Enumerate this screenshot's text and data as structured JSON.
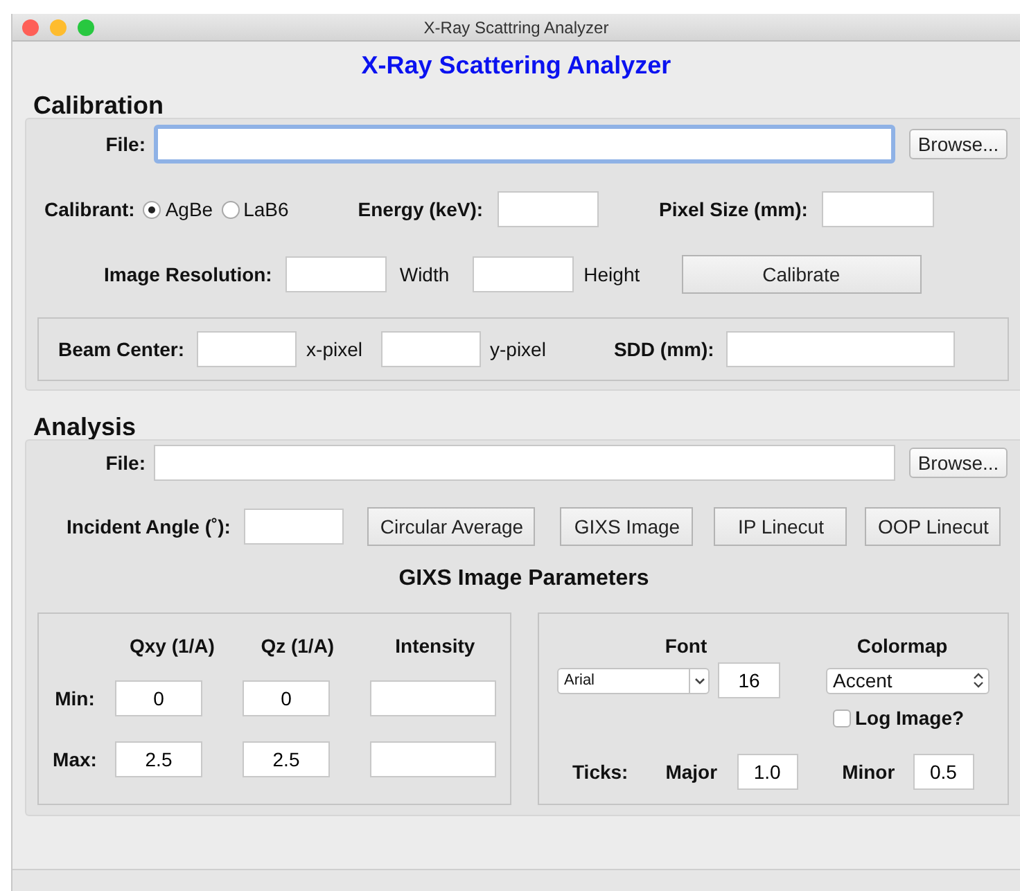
{
  "window": {
    "title": "X-Ray Scattring Analyzer"
  },
  "heading": "X-Ray Scattering Analyzer",
  "calibration": {
    "title": "Calibration",
    "file": {
      "label": "File:",
      "button": "Browse...",
      "focused": true
    },
    "calibrant": {
      "label": "Calibrant:",
      "options": [
        {
          "label": "AgBe",
          "selected": true
        },
        {
          "label": "LaB6",
          "selected": false
        }
      ]
    },
    "energy": {
      "label": "Energy (keV):"
    },
    "pixel_size": {
      "label": "Pixel Size (mm):"
    },
    "resolution": {
      "label": "Image Resolution:",
      "width_label": "Width",
      "height_label": "Height"
    },
    "calibrate_button": "Calibrate",
    "beam_center": {
      "label": "Beam Center:",
      "x_label": "x-pixel",
      "y_label": "y-pixel",
      "sdd_label": "SDD (mm):"
    }
  },
  "analysis": {
    "title": "Analysis",
    "file": {
      "label": "File:",
      "button": "Browse...",
      "focused": false
    },
    "incident_angle": {
      "label": "Incident Angle (˚):"
    },
    "buttons": [
      "Circular Average",
      "GIXS Image",
      "IP Linecut",
      "OOP Linecut"
    ],
    "parameters_title": "GIXS Image Parameters",
    "limits": {
      "columns": [
        "Qxy (1/A)",
        "Qz (1/A)",
        "Intensity"
      ],
      "rows": [
        {
          "label": "Min:",
          "values": [
            {
              "kind": "filled",
              "value": "0"
            },
            {
              "kind": "filled",
              "value": "0"
            },
            {
              "kind": "blank"
            }
          ]
        },
        {
          "label": "Max:",
          "values": [
            {
              "kind": "filled",
              "value": "2.5"
            },
            {
              "kind": "filled",
              "value": "2.5"
            },
            {
              "kind": "blank"
            }
          ]
        }
      ]
    },
    "display": {
      "font_label": "Font",
      "font": "Arial",
      "font_size": "16",
      "colormap_label": "Colormap",
      "colormap": "Accent",
      "log_image": {
        "label": "Log Image?",
        "checked": false
      },
      "ticks_label": "Ticks:",
      "major_label": "Major",
      "major": "1.0",
      "minor_label": "Minor",
      "minor": "0.5"
    }
  }
}
